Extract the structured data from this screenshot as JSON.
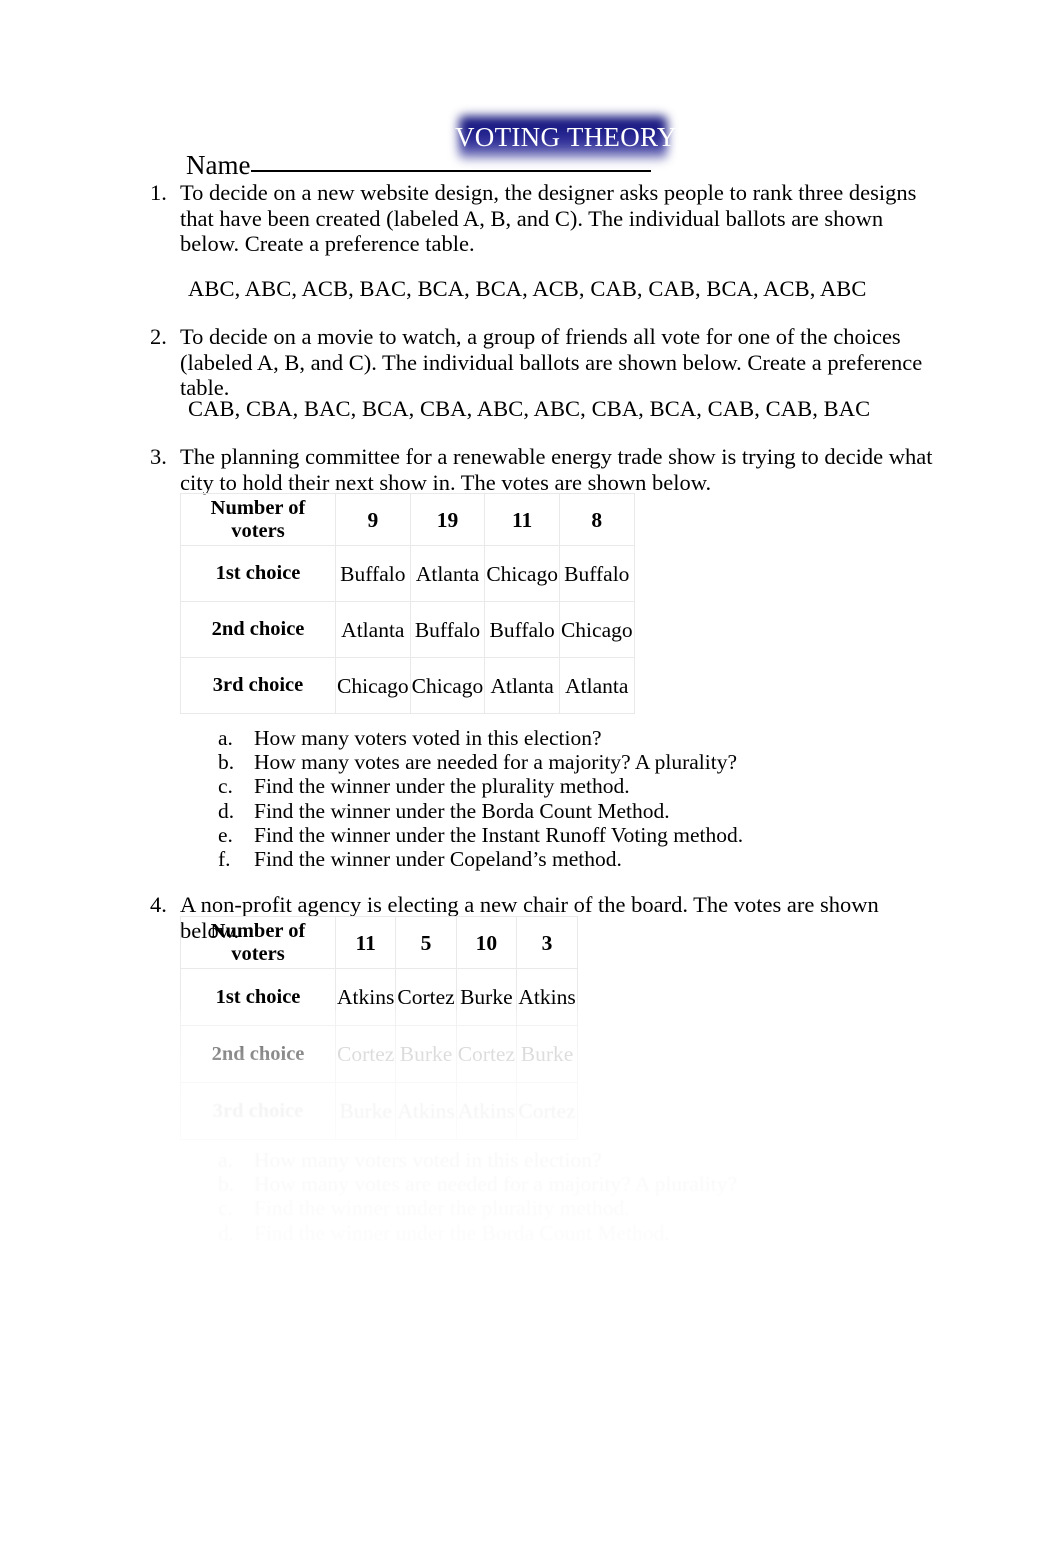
{
  "document": {
    "title": "VOTING THEORY",
    "name_label": "Name"
  },
  "questions": [
    {
      "number": "1.",
      "text": "To decide on a new website design, the designer asks people to rank three designs that have been created (labeled A, B, and C).  The individual ballots are shown below.  Create a preference table.",
      "ballots": "ABC,  ABC,  ACB,  BAC,  BCA,  BCA,  ACB,  CAB,  CAB,  BCA, ACB,  ABC"
    },
    {
      "number": "2.",
      "text": "To decide on a movie to watch, a group of friends all vote for one of the choices (labeled A, B, and C).  The individual ballots are shown below.  Create a preference table.",
      "ballots": "CAB,  CBA,  BAC,  BCA,  CBA,  ABC,  ABC,  CBA,  BCA,  CAB,  CAB,  BAC"
    },
    {
      "number": "3.",
      "text": "The planning committee for a renewable energy trade show is trying to decide what city to hold their next show in.  The votes are shown below."
    },
    {
      "number": "4.",
      "text": "A non-profit agency is electing a new chair of the board.  The votes are shown below."
    }
  ],
  "table_q3": {
    "row_headers": [
      "Number of voters",
      "1st choice",
      "2nd choice",
      "3rd choice"
    ],
    "voter_counts": [
      "9",
      "19",
      "11",
      "8"
    ],
    "rows": [
      {
        "label": "1st choice",
        "cells": [
          "Buffalo",
          "Atlanta",
          "Chicago",
          "Buffalo"
        ]
      },
      {
        "label": "2nd choice",
        "cells": [
          "Atlanta",
          "Buffalo",
          "Buffalo",
          "Chicago"
        ]
      },
      {
        "label": "3rd choice",
        "cells": [
          "Chicago",
          "Chicago",
          "Atlanta",
          "Atlanta"
        ]
      }
    ]
  },
  "table_q4": {
    "row_headers": [
      "Number of voters",
      "1st choice",
      "2nd choice",
      "3rd choice"
    ],
    "voter_counts": [
      "11",
      "5",
      "10",
      "3"
    ],
    "rows": [
      {
        "label": "1st choice",
        "cells": [
          "Atkins",
          "Cortez",
          "Burke",
          "Atkins"
        ]
      },
      {
        "label": "2nd choice",
        "cells": [
          "Cortez",
          "Burke",
          "Cortez",
          "Burke"
        ]
      },
      {
        "label": "3rd choice",
        "cells": [
          "Burke",
          "Atkins",
          "Atkins",
          "Cortez"
        ]
      }
    ]
  },
  "subquestions_q3": [
    {
      "label": "a.",
      "text": "How many voters voted in this election?"
    },
    {
      "label": "b.",
      "text": "How many votes are needed for a majority?  A plurality?"
    },
    {
      "label": "c.",
      "text": "Find the winner under the plurality method."
    },
    {
      "label": "d.",
      "text": "Find the winner under the Borda Count Method."
    },
    {
      "label": "e.",
      "text": "Find the winner under the Instant Runoff Voting method."
    },
    {
      "label": "f.",
      "text": "Find the winner under Copeland’s method."
    }
  ],
  "subquestions_q4": [
    {
      "label": "a.",
      "text": "How many voters voted in this election?"
    },
    {
      "label": "b.",
      "text": "How many votes are needed for a majority?  A plurality?"
    },
    {
      "label": "c.",
      "text": "Find the winner under the plurality method."
    },
    {
      "label": "d.",
      "text": "Find the winner under the Borda Count Method."
    }
  ],
  "colors": {
    "title_background_dark": "#14147a",
    "title_background_light": "#d6d6e8",
    "title_text": "#ffffff",
    "table_border": "#e9e9e9",
    "body_text": "#000000"
  }
}
